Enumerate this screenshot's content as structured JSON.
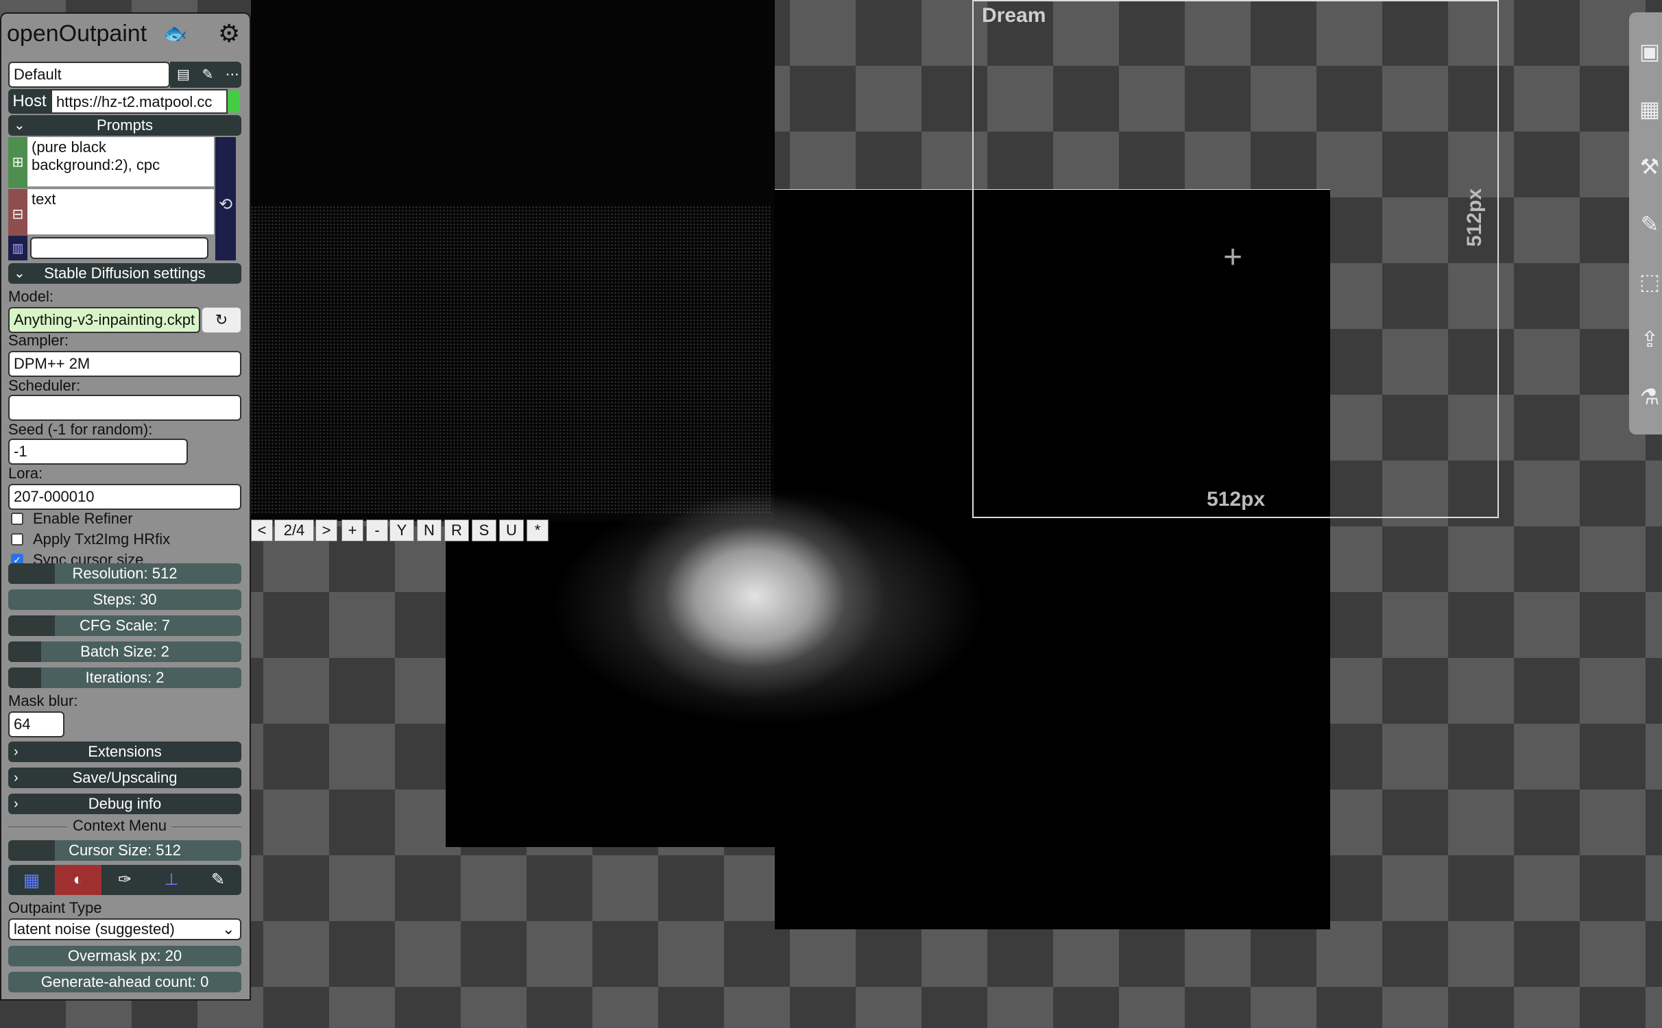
{
  "app": {
    "title": "openOutpaint",
    "fish_icon": "fish-icon",
    "settings_icon": "gear-icon"
  },
  "profile": {
    "value": "Default",
    "save_icon": "save-icon",
    "edit_icon": "edit-icon",
    "more_icon": "more-icon"
  },
  "host": {
    "label": "Host",
    "value": "https://hz-t2.matpool.cc"
  },
  "prompts": {
    "header": "Prompts",
    "positive": "(pure black background:2), cpc",
    "negative": "text",
    "style": ""
  },
  "sd_settings": {
    "header": "Stable Diffusion settings",
    "model_label": "Model:",
    "model_value": "Anything-v3-inpainting.ckpt",
    "sampler_label": "Sampler:",
    "sampler_value": "DPM++ 2M",
    "scheduler_label": "Scheduler:",
    "scheduler_value": "",
    "seed_label": "Seed (-1 for random):",
    "seed_value": "-1",
    "lora_label": "Lora:",
    "lora_value": "207-000010",
    "enable_refiner": "Enable Refiner",
    "apply_hrfix": "Apply Txt2Img HRfix",
    "sync_cursor": "Sync cursor size",
    "enable_refiner_checked": false,
    "apply_hrfix_checked": false,
    "sync_cursor_checked": true
  },
  "sliders": {
    "resolution": {
      "label": "Resolution: 512",
      "level": 0.2
    },
    "steps": {
      "label": "Steps: 30",
      "level": 0.0
    },
    "cfg": {
      "label": "CFG Scale: 7",
      "level": 0.2
    },
    "batch": {
      "label": "Batch Size: 2",
      "level": 0.14
    },
    "iterations": {
      "label": "Iterations: 2",
      "level": 0.14
    },
    "cursor": {
      "label": "Cursor Size: 512",
      "level": 0.2
    },
    "overmask": {
      "label": "Overmask px: 20",
      "level": 0.0
    },
    "generate_ahead": {
      "label": "Generate-ahead count: 0",
      "level": 0.0
    }
  },
  "mask_blur": {
    "label": "Mask blur:",
    "value": "64"
  },
  "sections": {
    "extensions": "Extensions",
    "save_upscaling": "Save/Upscaling",
    "debug": "Debug info"
  },
  "context_menu": {
    "label": "Context Menu"
  },
  "tools": [
    "grid-icon",
    "mask-icon",
    "brush-icon",
    "pin-icon",
    "pen-icon"
  ],
  "outpaint": {
    "label": "Outpaint Type",
    "value": "latent noise (suggested)"
  },
  "canvas_toolbar": {
    "prev": "<",
    "counter": "2/4",
    "next": ">",
    "plus": "+",
    "minus": "-",
    "y": "Y",
    "n": "N",
    "r": "R",
    "s": "S",
    "u": "U",
    "star": "*"
  },
  "canvas": {
    "dream_label": "Dream",
    "px_label": "512px",
    "px_label_vertical": "512px"
  },
  "right_toolbar": [
    "dream-icon",
    "img2img-icon",
    "stamp-icon",
    "pen-icon",
    "select-icon",
    "upload-icon",
    "interrogate-icon"
  ],
  "colors": {
    "host_ok": "#44cc44",
    "model_bg": "#d8f5c8",
    "slider_bg": "#49605e",
    "section_bg": "#2d3838",
    "tool_active": "#a03030"
  }
}
